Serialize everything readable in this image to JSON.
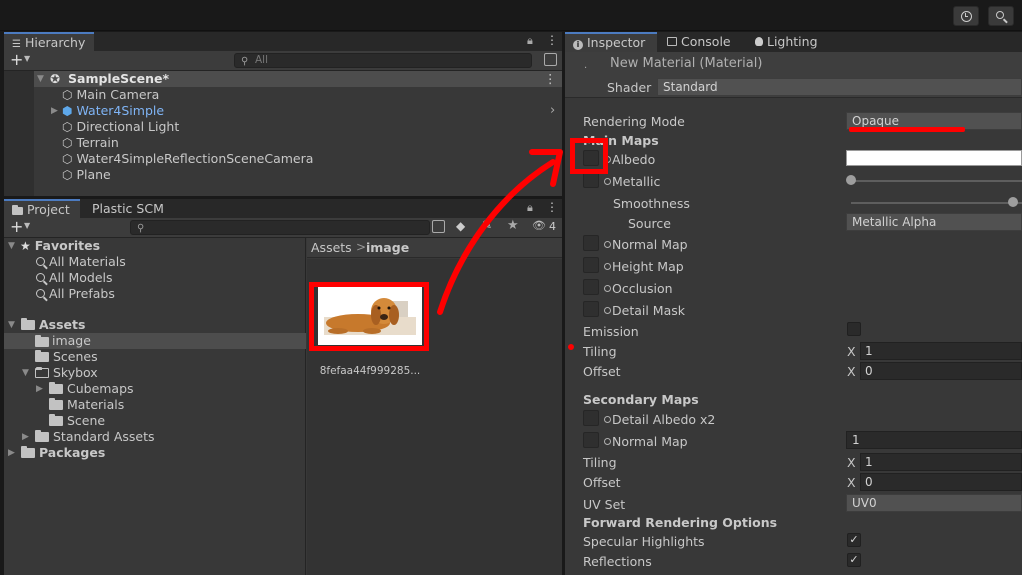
{
  "toolbar": {
    "history_icon": "history-icon",
    "search_icon": "search-icon"
  },
  "hierarchy": {
    "tab_label": "Hierarchy",
    "add_label": "+",
    "search_placeholder": "All",
    "scene": "SampleScene*",
    "items": [
      "Main Camera",
      "Water4Simple",
      "Directional Light",
      "Terrain",
      "Water4SimpleReflectionSceneCamera",
      "Plane"
    ]
  },
  "project": {
    "tabs": [
      "Project",
      "Plastic SCM"
    ],
    "hidden_count": "4",
    "favorites_label": "Favorites",
    "favorites": [
      "All Materials",
      "All Models",
      "All Prefabs"
    ],
    "assets_label": "Assets",
    "assets_children": [
      "image",
      "Scenes",
      "Skybox"
    ],
    "skybox_children": [
      "Cubemaps",
      "Materials",
      "Scene"
    ],
    "standard_assets": "Standard Assets",
    "packages": "Packages",
    "breadcrumb_root": "Assets",
    "breadcrumb_sep": ">",
    "breadcrumb_current": "image",
    "file_name": "8fefaa44f999285..."
  },
  "inspector": {
    "tabs": [
      "Inspector",
      "Console",
      "Lighting"
    ],
    "material_title": "New Material (Material)",
    "shader_label": "Shader",
    "shader_value": "Standard",
    "rendering_mode_label": "Rendering Mode",
    "rendering_mode_value": "Opaque",
    "main_maps": "Main Maps",
    "albedo": "Albedo",
    "metallic": "Metallic",
    "smoothness": "Smoothness",
    "source_label": "Source",
    "source_value": "Metallic Alpha",
    "normal_map": "Normal Map",
    "height_map": "Height Map",
    "occlusion": "Occlusion",
    "detail_mask": "Detail Mask",
    "emission": "Emission",
    "tiling": "Tiling",
    "offset": "Offset",
    "x": "X",
    "tiling_x": "1",
    "offset_x": "0",
    "secondary_maps": "Secondary Maps",
    "detail_albedo": "Detail Albedo x2",
    "normal_map_2": "Normal Map",
    "normal_scale": "1",
    "tiling2_x": "1",
    "offset2_x": "0",
    "uv_set_label": "UV Set",
    "uv_set_value": "UV0",
    "forward_rendering": "Forward Rendering Options",
    "specular_highlights": "Specular Highlights",
    "reflections": "Reflections"
  },
  "colors": {
    "annotation": "#ff0000",
    "accent": "#4c7bc0",
    "water_text": "#7fb4f5"
  }
}
